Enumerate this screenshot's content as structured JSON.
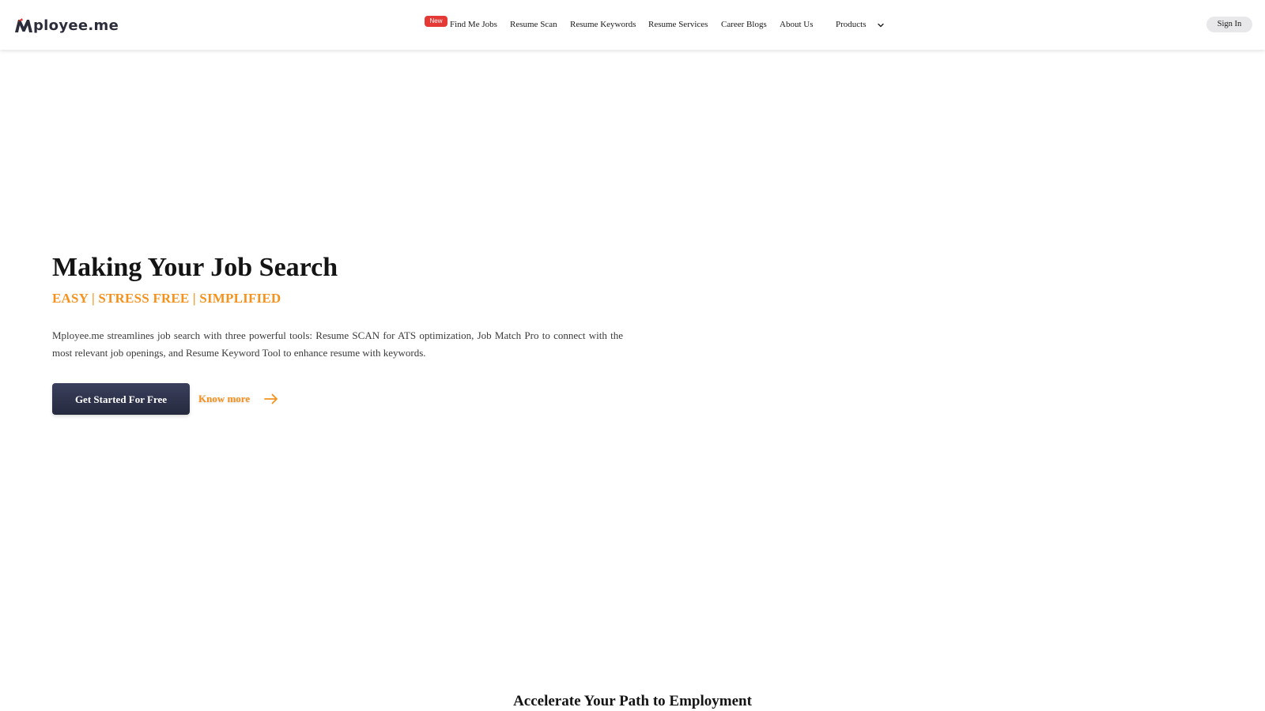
{
  "header": {
    "logo_text": "ployee.me",
    "nav": [
      {
        "label": "Find Me Jobs",
        "badge": "New"
      },
      {
        "label": "Resume Scan"
      },
      {
        "label": "Resume Keywords"
      },
      {
        "label": "Resume Services"
      },
      {
        "label": "Career Blogs"
      },
      {
        "label": "About Us"
      },
      {
        "label": "Products"
      }
    ],
    "signin_label": "Sign In"
  },
  "hero": {
    "title": "Making Your Job Search",
    "subtitle": "EASY | STRESS FREE | SIMPLIFIED",
    "description": "Mployee.me streamlines job search with three powerful tools: Resume SCAN for ATS optimization, Job Match Pro to connect with the most relevant job openings, and Resume Keyword Tool to enhance resume with keywords.",
    "cta_primary": "Get Started For Free",
    "cta_secondary": "Know more"
  },
  "section": {
    "title": "Accelerate Your Path to Employment"
  },
  "icons": {
    "logo": "m-logo-icon",
    "products_dropdown": "chevron-down-icon",
    "know_more": "arrow-right-icon"
  },
  "colors": {
    "accent": "#f5921e",
    "badge": "#e53935",
    "primary_button": "#2b2f47",
    "signin_bg": "#e8e8ea",
    "logo_red": "#e53935",
    "logo_dark": "#2b2d3a"
  }
}
